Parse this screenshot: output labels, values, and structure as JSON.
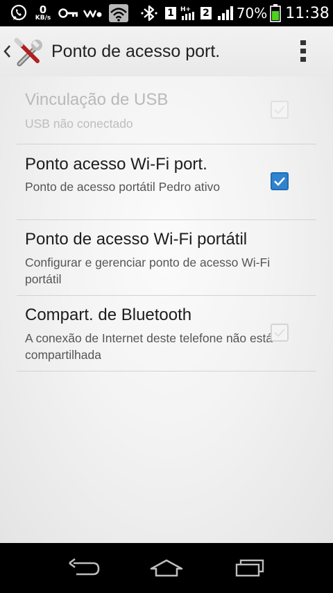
{
  "status_bar": {
    "net_speed_value": "0",
    "net_speed_unit": "KB/s",
    "sim1": "1",
    "sim2": "2",
    "network_type": "H+",
    "battery_percent": "70%",
    "time": "11:38",
    "icons": [
      "whatsapp-icon",
      "key-icon",
      "walkman-icon",
      "wifi-hotspot-icon",
      "bluetooth-icon",
      "signal-icon",
      "battery-icon"
    ]
  },
  "app_bar": {
    "title": "Ponto de acesso port.",
    "icons": [
      "back-chevron-icon",
      "settings-tools-icon",
      "overflow-menu-icon"
    ]
  },
  "settings": [
    {
      "title": "Vinculação de USB",
      "summary": "USB não conectado",
      "checkbox": "unchecked",
      "enabled": false
    },
    {
      "title": "Ponto acesso Wi-Fi port.",
      "summary": "Ponto de acesso portátil Pedro ativo",
      "checkbox": "checked",
      "enabled": true
    },
    {
      "title": "Ponto de acesso Wi-Fi portátil",
      "summary": "Configurar e gerenciar ponto de acesso Wi-Fi portátil",
      "checkbox": "none",
      "enabled": true
    },
    {
      "title": "Compart. de Bluetooth",
      "summary": "A conexão de Internet deste telefone não está compartilhada",
      "checkbox": "unchecked",
      "enabled": true
    }
  ],
  "nav_bar": {
    "icons": [
      "back-arrow-icon",
      "home-icon",
      "recent-apps-icon"
    ]
  },
  "colors": {
    "accent": "#2f83cf",
    "status_bar_bg": "#000000",
    "nav_bar_bg": "#000000"
  }
}
